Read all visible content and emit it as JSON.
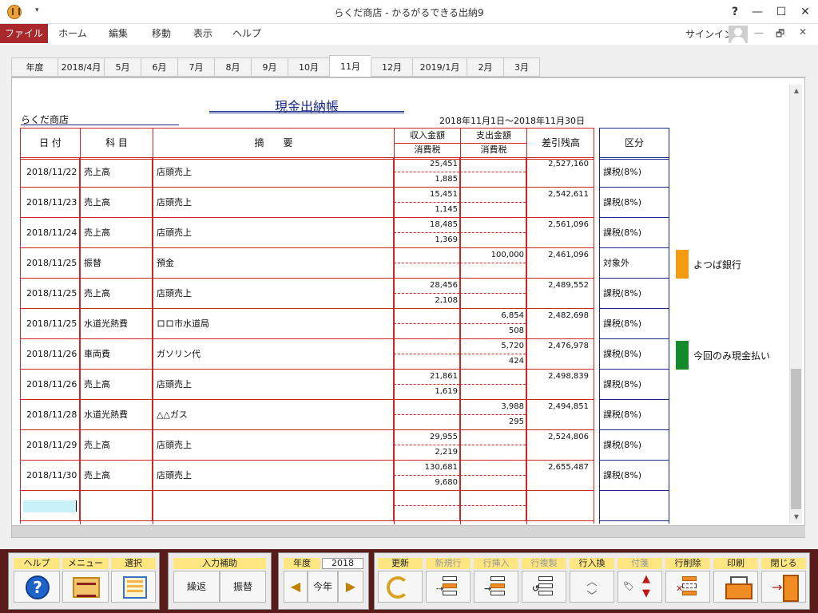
{
  "window": {
    "title": "らくだ商店 - かるがるできる出納9",
    "help_btn": "?",
    "minimize": "—",
    "restore": "☐",
    "close": "✕"
  },
  "menu": {
    "file": "ファイル",
    "home": "ホーム",
    "edit": "編集",
    "move": "移動",
    "view": "表示",
    "help": "ヘルプ",
    "signin": "サインイン",
    "mini_min": "—",
    "mini_restore": "🗗",
    "mini_close": "✕"
  },
  "tabs": [
    "年度",
    "2018/4月",
    "5月",
    "6月",
    "7月",
    "8月",
    "9月",
    "10月",
    "11月",
    "12月",
    "2019/1月",
    "2月",
    "3月"
  ],
  "active_tab": "11月",
  "ledger": {
    "title": "現金出納帳",
    "shop": "らくだ商店",
    "period": "2018年11月1日～2018年11月30日",
    "headers": {
      "date": "日 付",
      "subject": "科 目",
      "desc": "摘　　要",
      "income": "収入金額",
      "income_tax": "消費税",
      "expense": "支出金額",
      "expense_tax": "消費税",
      "balance": "差引残高",
      "category": "区分"
    },
    "rows": [
      {
        "date": "2018/11/22",
        "subject": "売上高",
        "desc": "店頭売上",
        "income": "25,451",
        "income_tax": "1,885",
        "expense": "",
        "expense_tax": "",
        "balance": "2,527,160",
        "category": "課税(8%)"
      },
      {
        "date": "2018/11/23",
        "subject": "売上高",
        "desc": "店頭売上",
        "income": "15,451",
        "income_tax": "1,145",
        "expense": "",
        "expense_tax": "",
        "balance": "2,542,611",
        "category": "課税(8%)"
      },
      {
        "date": "2018/11/24",
        "subject": "売上高",
        "desc": "店頭売上",
        "income": "18,485",
        "income_tax": "1,369",
        "expense": "",
        "expense_tax": "",
        "balance": "2,561,096",
        "category": "課税(8%)"
      },
      {
        "date": "2018/11/25",
        "subject": "振替",
        "desc": "預金",
        "income": "",
        "income_tax": "",
        "expense": "100,000",
        "expense_tax": "",
        "balance": "2,461,096",
        "category": "対象外"
      },
      {
        "date": "2018/11/25",
        "subject": "売上高",
        "desc": "店頭売上",
        "income": "28,456",
        "income_tax": "2,108",
        "expense": "",
        "expense_tax": "",
        "balance": "2,489,552",
        "category": "課税(8%)"
      },
      {
        "date": "2018/11/25",
        "subject": "水道光熱費",
        "desc": "ロロ市水道局",
        "income": "",
        "income_tax": "",
        "expense": "6,854",
        "expense_tax": "508",
        "balance": "2,482,698",
        "category": "課税(8%)"
      },
      {
        "date": "2018/11/26",
        "subject": "車両費",
        "desc": "ガソリン代",
        "income": "",
        "income_tax": "",
        "expense": "5,720",
        "expense_tax": "424",
        "balance": "2,476,978",
        "category": "課税(8%)"
      },
      {
        "date": "2018/11/26",
        "subject": "売上高",
        "desc": "店頭売上",
        "income": "21,861",
        "income_tax": "1,619",
        "expense": "",
        "expense_tax": "",
        "balance": "2,498,839",
        "category": "課税(8%)"
      },
      {
        "date": "2018/11/28",
        "subject": "水道光熱費",
        "desc": "△△ガス",
        "income": "",
        "income_tax": "",
        "expense": "3,988",
        "expense_tax": "295",
        "balance": "2,494,851",
        "category": "課税(8%)"
      },
      {
        "date": "2018/11/29",
        "subject": "売上高",
        "desc": "店頭売上",
        "income": "29,955",
        "income_tax": "2,219",
        "expense": "",
        "expense_tax": "",
        "balance": "2,524,806",
        "category": "課税(8%)"
      },
      {
        "date": "2018/11/30",
        "subject": "売上高",
        "desc": "店頭売上",
        "income": "130,681",
        "income_tax": "9,680",
        "expense": "",
        "expense_tax": "",
        "balance": "2,655,487",
        "category": "課税(8%)"
      }
    ],
    "memos": [
      {
        "row": 3,
        "text": "よつば銀行",
        "color": "#f39c12"
      },
      {
        "row": 6,
        "text": "今回のみ現金払い",
        "color": "#138a2c"
      }
    ]
  },
  "toolbar": {
    "help": "ヘルプ",
    "help_glyph": "?",
    "menu": "メニュー",
    "select": "選択",
    "input_assist": "入力補助",
    "carry": "繰返",
    "transfer": "振替",
    "year_label": "年度",
    "year_value": "2018",
    "this_year": "今年",
    "prev": "◀",
    "next": "▶",
    "refresh": "更新",
    "new_row": "新規行",
    "insert_row": "行挿入",
    "copy_row": "行複製",
    "swap_row": "行入換",
    "tag": "付箋",
    "delete_row": "行削除",
    "print": "印刷",
    "close": "閉じる"
  }
}
